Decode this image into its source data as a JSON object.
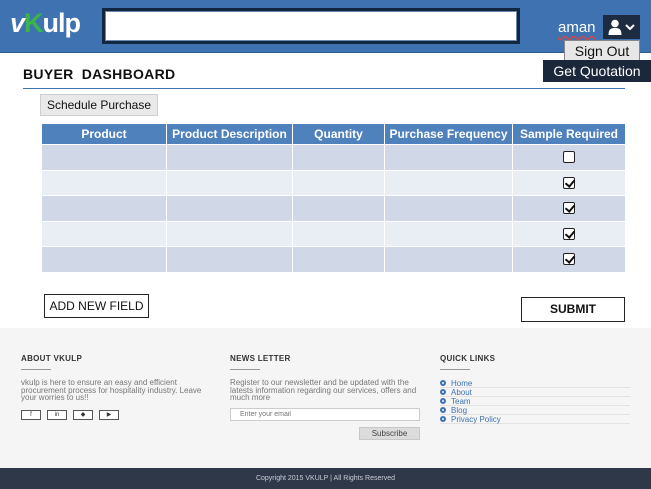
{
  "header": {
    "logo": {
      "v": "v",
      "k": "K",
      "rest": "ulp"
    },
    "search": {
      "value": "",
      "placeholder": ""
    },
    "username": "aman",
    "sign_out": "Sign Out",
    "get_quotation": "Get Quotation"
  },
  "main": {
    "title": "BUYER  DASHBOARD",
    "schedule_button": "Schedule Purchase",
    "table": {
      "columns": [
        "Product",
        "Product Description",
        "Quantity",
        "Purchase Frequency",
        "Sample Required"
      ],
      "rows": [
        {
          "product": "",
          "description": "",
          "quantity": "",
          "frequency": "",
          "sample_required": false
        },
        {
          "product": "",
          "description": "",
          "quantity": "",
          "frequency": "",
          "sample_required": true
        },
        {
          "product": "",
          "description": "",
          "quantity": "",
          "frequency": "",
          "sample_required": true
        },
        {
          "product": "",
          "description": "",
          "quantity": "",
          "frequency": "",
          "sample_required": true
        },
        {
          "product": "",
          "description": "",
          "quantity": "",
          "frequency": "",
          "sample_required": true
        }
      ]
    },
    "add_field_button": "ADD NEW FIELD",
    "submit_button": "SUBMIT"
  },
  "footer": {
    "about": {
      "heading": "ABOUT VKULP",
      "text": "vkulp is here to ensure an easy and efficient procurement process for hospitality industry. Leave your worries to us!!",
      "social_icons": [
        "facebook-icon",
        "linkedin-icon",
        "twitter-icon",
        "youtube-icon"
      ]
    },
    "newsletter": {
      "heading": "NEWS LETTER",
      "text": "Register to our newsletter and be updated with the latests information regarding our services, offers and much more",
      "email_placeholder": "Enter your email",
      "subscribe": "Subscribe"
    },
    "quick_links": {
      "heading": "QUICK LINKS",
      "items": [
        "Home",
        "About",
        "Team",
        "Blog",
        "Privacy Policy"
      ]
    },
    "copyright": "Copyright 2015 VKULP | All Rights Reserved"
  },
  "colors": {
    "header_bg": "#3f72b0",
    "table_header": "#4f81bd",
    "row_dark": "#d0d8e8",
    "row_light": "#e9edf4",
    "footer_bar": "#2e3849"
  }
}
